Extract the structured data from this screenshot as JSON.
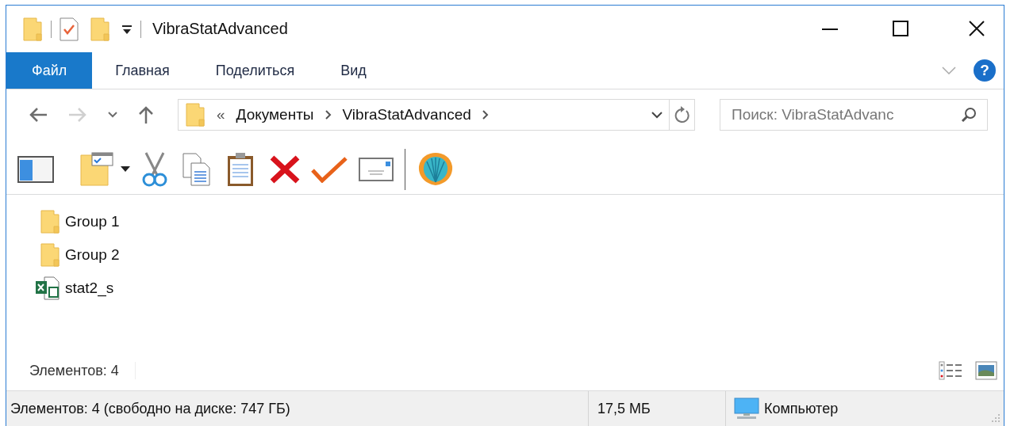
{
  "window": {
    "title": "VibraStatAdvanced"
  },
  "tabs": [
    {
      "label": "Файл",
      "selected": true
    },
    {
      "label": "Главная",
      "selected": false
    },
    {
      "label": "Поделиться",
      "selected": false
    },
    {
      "label": "Вид",
      "selected": false
    }
  ],
  "help": "?",
  "nav_buttons": [
    {
      "kind": "back",
      "disabled": false
    },
    {
      "kind": "forward",
      "disabled": true
    },
    {
      "kind": "recent",
      "disabled": false
    },
    {
      "kind": "up",
      "disabled": false
    }
  ],
  "address": {
    "overflow": "«",
    "breadcrumbs": [
      "Документы",
      "VibraStatAdvanced"
    ]
  },
  "search": {
    "placeholder": "Поиск: VibraStatAdvanc"
  },
  "items": [
    {
      "name": "Group 1",
      "kind": "folder"
    },
    {
      "name": "Group 2",
      "kind": "folder"
    },
    {
      "name": "stat2_s",
      "kind": "excel"
    }
  ],
  "item_count": "Элементов: 4",
  "status_bar": [
    "Элементов: 4 (свободно на диске: 747 ГБ)",
    "17,5 МБ",
    "Компьютер"
  ]
}
